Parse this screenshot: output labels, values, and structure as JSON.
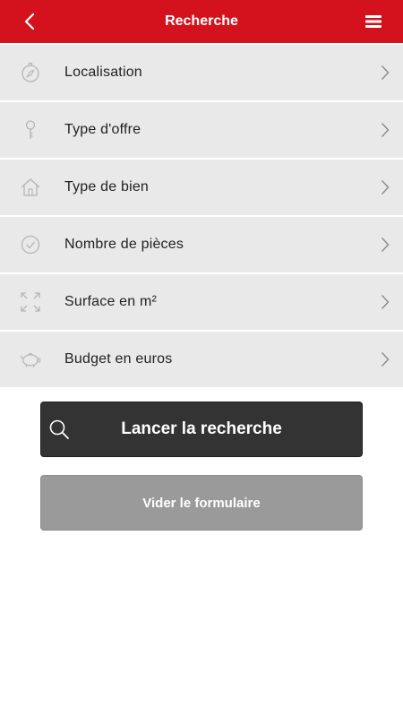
{
  "header": {
    "title": "Recherche",
    "back_icon": "chevron-left-icon",
    "menu_icon": "hamburger-menu-icon",
    "background_color": "#d3121e"
  },
  "criteria": [
    {
      "label": "Localisation",
      "icon": "compass-icon"
    },
    {
      "label": "Type d'offre",
      "icon": "key-icon"
    },
    {
      "label": "Type de bien",
      "icon": "house-icon"
    },
    {
      "label": "Nombre de pièces",
      "icon": "check-circle-icon"
    },
    {
      "label": "Surface en m²",
      "icon": "expand-icon"
    },
    {
      "label": "Budget en euros",
      "icon": "piggy-bank-icon"
    }
  ],
  "actions": {
    "search_label": "Lancer la recherche",
    "search_icon": "search-icon",
    "clear_label": "Vider le formulaire"
  }
}
